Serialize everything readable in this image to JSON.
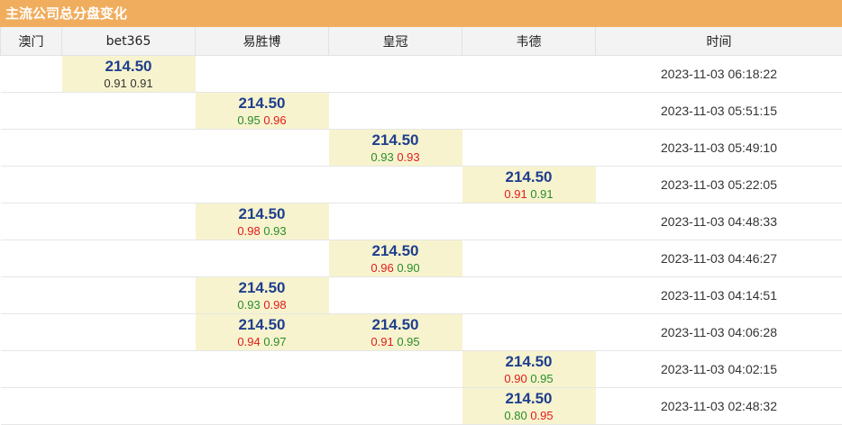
{
  "title": "主流公司总分盘变化",
  "columns": [
    "澳门",
    "bet365",
    "易胜博",
    "皇冠",
    "韦德",
    "时间"
  ],
  "colors": {
    "header": "#f0ad5d",
    "highlight": "#f7f3ce",
    "line": "#1f3f8e",
    "up": "#e11b1b",
    "down": "#2a8c2a"
  },
  "rows": [
    {
      "time": "2023-11-03 06:18:22",
      "cells": [
        null,
        {
          "line": "214.50",
          "over": "0.91",
          "under": "0.91",
          "overColor": "gray",
          "underColor": "gray"
        },
        null,
        null,
        null
      ]
    },
    {
      "time": "2023-11-03 05:51:15",
      "cells": [
        null,
        null,
        {
          "line": "214.50",
          "over": "0.95",
          "under": "0.96",
          "overColor": "green",
          "underColor": "red"
        },
        null,
        null
      ]
    },
    {
      "time": "2023-11-03 05:49:10",
      "cells": [
        null,
        null,
        null,
        {
          "line": "214.50",
          "over": "0.93",
          "under": "0.93",
          "overColor": "green",
          "underColor": "red"
        },
        null
      ]
    },
    {
      "time": "2023-11-03 05:22:05",
      "cells": [
        null,
        null,
        null,
        null,
        {
          "line": "214.50",
          "over": "0.91",
          "under": "0.91",
          "overColor": "red",
          "underColor": "green"
        }
      ]
    },
    {
      "time": "2023-11-03 04:48:33",
      "cells": [
        null,
        null,
        {
          "line": "214.50",
          "over": "0.98",
          "under": "0.93",
          "overColor": "red",
          "underColor": "green"
        },
        null,
        null
      ]
    },
    {
      "time": "2023-11-03 04:46:27",
      "cells": [
        null,
        null,
        null,
        {
          "line": "214.50",
          "over": "0.96",
          "under": "0.90",
          "overColor": "red",
          "underColor": "green"
        },
        null
      ]
    },
    {
      "time": "2023-11-03 04:14:51",
      "cells": [
        null,
        null,
        {
          "line": "214.50",
          "over": "0.93",
          "under": "0.98",
          "overColor": "green",
          "underColor": "red"
        },
        null,
        null
      ]
    },
    {
      "time": "2023-11-03 04:06:28",
      "cells": [
        null,
        null,
        {
          "line": "214.50",
          "over": "0.94",
          "under": "0.97",
          "overColor": "red",
          "underColor": "green"
        },
        {
          "line": "214.50",
          "over": "0.91",
          "under": "0.95",
          "overColor": "red",
          "underColor": "green"
        },
        null
      ]
    },
    {
      "time": "2023-11-03 04:02:15",
      "cells": [
        null,
        null,
        null,
        null,
        {
          "line": "214.50",
          "over": "0.90",
          "under": "0.95",
          "overColor": "red",
          "underColor": "green"
        }
      ]
    },
    {
      "time": "2023-11-03 02:48:32",
      "cells": [
        null,
        null,
        null,
        null,
        {
          "line": "214.50",
          "over": "0.80",
          "under": "0.95",
          "overColor": "green",
          "underColor": "red"
        }
      ]
    }
  ]
}
